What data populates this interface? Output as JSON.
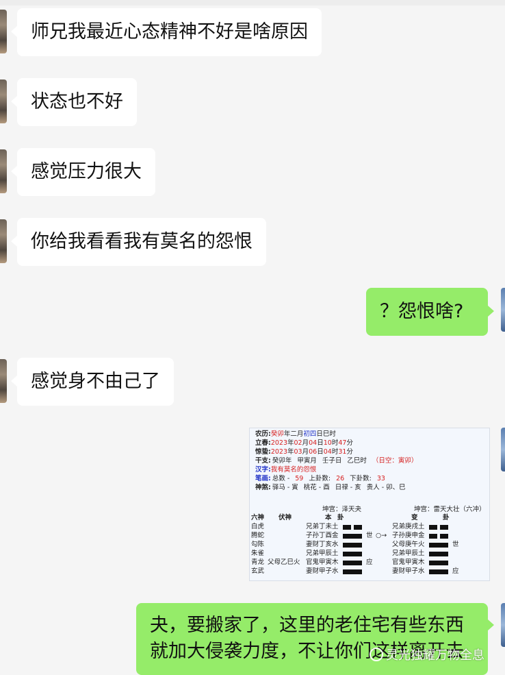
{
  "messages": [
    {
      "side": "left",
      "text": "师兄我最近心态精神不好是啥原因"
    },
    {
      "side": "left",
      "text": "状态也不好"
    },
    {
      "side": "left",
      "text": "感觉压力很大"
    },
    {
      "side": "left",
      "text": "你给我看看我有莫名的怨恨"
    },
    {
      "side": "right",
      "text": "？怨恨啥?"
    },
    {
      "side": "left",
      "text": "感觉身不由己了"
    },
    {
      "side": "right",
      "lines": [
        "夬，要搬家了，这里的老住宅有些东西",
        "就加大侵袭力度，不让你们这样离开去"
      ]
    }
  ],
  "divination_card": {
    "rows": [
      {
        "label": "农历:",
        "parts": [
          "癸卯",
          "年二月",
          "初四",
          "日巳时"
        ]
      },
      {
        "label": "立春:",
        "parts": [
          "2023",
          "年",
          "02",
          "月",
          "04",
          "日",
          "10",
          "时",
          "47",
          "分"
        ]
      },
      {
        "label": "惊蛰:",
        "parts": [
          "2023",
          "年",
          "03",
          "月",
          "06",
          "日",
          "04",
          "时",
          "31",
          "分"
        ]
      },
      {
        "label": "干支:",
        "parts": [
          "癸卯年",
          "甲寅月",
          "壬子日",
          "乙巳时",
          "（日空：寅卯）"
        ]
      },
      {
        "label": "汉字:",
        "parts": [
          "我有莫名的怨恨"
        ]
      },
      {
        "label": "笔画:",
        "parts": [
          "总数 -",
          "59",
          "上卦数:",
          "26",
          "下卦数:",
          "33"
        ]
      },
      {
        "label": "神煞:",
        "parts": [
          "驿马 - 寅",
          "桃花 - 酉",
          "日禄 - 亥",
          "贵人 - 卯、巳"
        ]
      }
    ],
    "palace_left": "坤宫：泽天夬",
    "palace_right": "坤宫：雷天大壮（六冲）",
    "headers": [
      "六神",
      "伏神",
      "本",
      "卦",
      "变",
      "卦"
    ],
    "six_spirits": [
      "白虎",
      "腾蛇",
      "勾陈",
      "朱雀",
      "青龙",
      "玄武"
    ],
    "hidden_spirit": "父母乙巳火",
    "ben_lines": [
      "兄弟丁未土",
      "子孙丁酉金",
      "妻财丁亥水",
      "兄弟甲辰土",
      "官鬼甲寅木",
      "妻财甲子水"
    ],
    "ben_types": [
      "yin",
      "yang",
      "yang",
      "yang",
      "yang",
      "yang"
    ],
    "ben_marks": [
      "",
      "世",
      "",
      "",
      "应",
      ""
    ],
    "change_arrow": "○→",
    "bian_lines": [
      "兄弟庚戌土",
      "子孙庚申金",
      "父母庚午火",
      "兄弟甲辰土",
      "官鬼甲寅木",
      "妻财甲子水"
    ],
    "bian_types": [
      "yin",
      "yin",
      "yang",
      "yang",
      "yang",
      "yang"
    ],
    "bian_marks": [
      "",
      "",
      "世",
      "",
      "",
      "应"
    ]
  },
  "watermark": "灵光独耀万物全息",
  "colors": {
    "incoming_bubble": "#ffffff",
    "outgoing_bubble": "#95ec69",
    "background": "#f5f5f5"
  }
}
